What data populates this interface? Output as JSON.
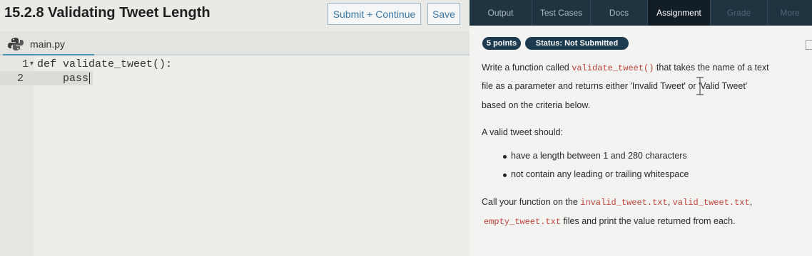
{
  "header": {
    "title": "15.2.8 Validating Tweet Length",
    "submit_label": "Submit + Continue",
    "save_label": "Save"
  },
  "tabs": [
    {
      "label": "Output"
    },
    {
      "label": "Test Cases"
    },
    {
      "label": "Docs"
    },
    {
      "label": "Assignment"
    },
    {
      "label": "Grade"
    },
    {
      "label": "More"
    }
  ],
  "editor": {
    "file_name": "main.py",
    "lines": [
      {
        "num": "1",
        "marker": "▾",
        "text": "def validate_tweet():"
      },
      {
        "num": "2",
        "marker": "",
        "text": "    pass"
      }
    ]
  },
  "assignment": {
    "points": "5 points",
    "status": "Status: Not Submitted",
    "p1_a": "Write a function called ",
    "p1_code": "validate_tweet()",
    "p1_b": " that takes the name of a text",
    "p2": "file as a parameter and returns either 'Invalid Tweet' or 'Valid Tweet'",
    "p3": "based on the criteria below.",
    "p4": "A valid tweet should:",
    "bullets": [
      "have a length between 1 and 280 characters",
      "not contain any leading or trailing whitespace"
    ],
    "p5_a": "Call your function on the ",
    "p5_code1": "invalid_tweet.txt",
    "p5_sep": ", ",
    "p5_code2": "valid_tweet.txt",
    "p5_comma": ",",
    "p6_code": "empty_tweet.txt",
    "p6_b": " files and print the value returned from each."
  }
}
